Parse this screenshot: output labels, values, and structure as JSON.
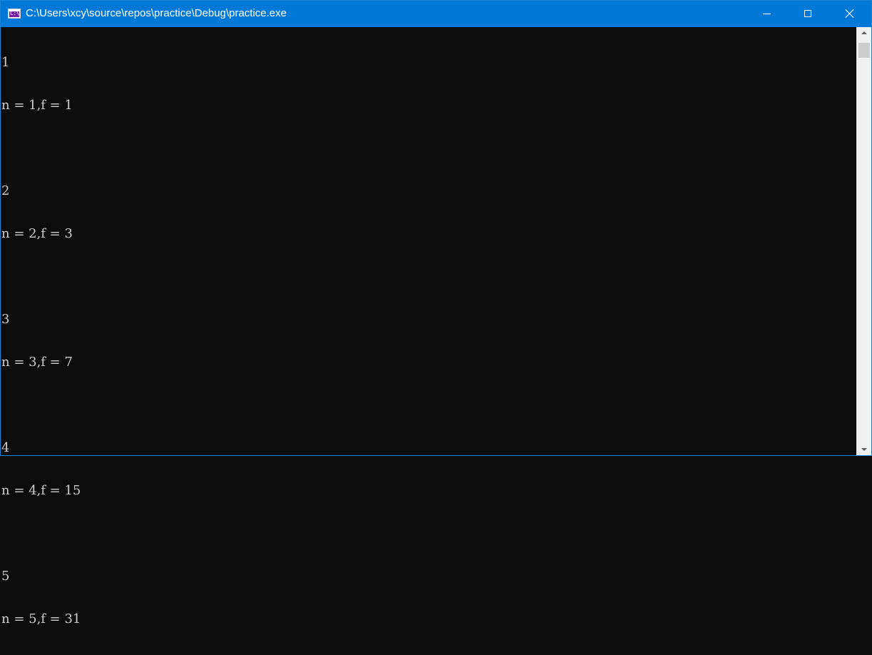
{
  "window": {
    "title": "C:\\Users\\xcy\\source\\repos\\practice\\Debug\\practice.exe",
    "app_icon_text": "C:\\",
    "colors": {
      "titlebar": "#0078d7",
      "console_bg": "#0c0c0c",
      "console_text": "#cccccc",
      "icon": "#7a1fa2"
    },
    "controls": {
      "minimize": "minimize-icon",
      "maximize": "maximize-icon",
      "close": "close-icon"
    }
  },
  "console": {
    "lines": [
      "1",
      "n = 1,f = 1",
      "",
      "2",
      "n = 2,f = 3",
      "",
      "3",
      "n = 3,f = 7",
      "",
      "4",
      "n = 4,f = 15",
      "",
      "5",
      "n = 5,f = 31"
    ]
  }
}
